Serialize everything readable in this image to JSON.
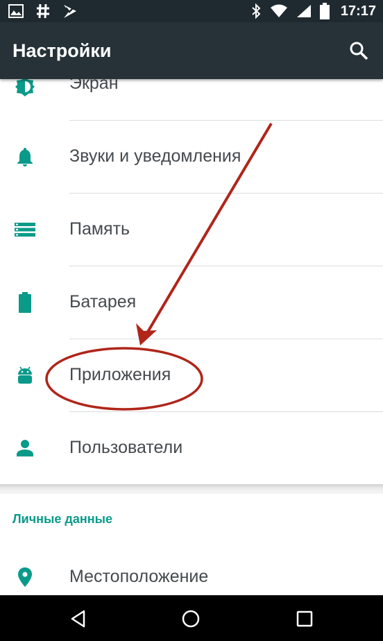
{
  "status_bar": {
    "time": "17:17",
    "left_icons": [
      "image-icon",
      "hash-icon",
      "check-shield-icon"
    ],
    "right_icons": [
      "bluetooth-icon",
      "wifi-icon",
      "signal-icon",
      "battery-icon"
    ]
  },
  "toolbar": {
    "title": "Настройки",
    "search_icon": "search-icon",
    "background": "#263238"
  },
  "settings": {
    "items": [
      {
        "label": "Экран",
        "icon": "brightness-icon"
      },
      {
        "label": "Звуки и уведомления",
        "icon": "bell-icon"
      },
      {
        "label": "Память",
        "icon": "storage-icon"
      },
      {
        "label": "Батарея",
        "icon": "battery-icon"
      },
      {
        "label": "Приложения",
        "icon": "android-icon"
      },
      {
        "label": "Пользователи",
        "icon": "person-icon"
      }
    ],
    "section_title": "Личные данные",
    "section_items": [
      {
        "label": "Местоположение",
        "icon": "location-pin-icon"
      }
    ],
    "accent_color": "#0a9a8a"
  },
  "nav_bar": {
    "buttons": [
      "back-icon",
      "home-icon",
      "recents-icon"
    ]
  },
  "annotation": {
    "color": "#b0251a",
    "highlighted_item": "Приложения"
  }
}
